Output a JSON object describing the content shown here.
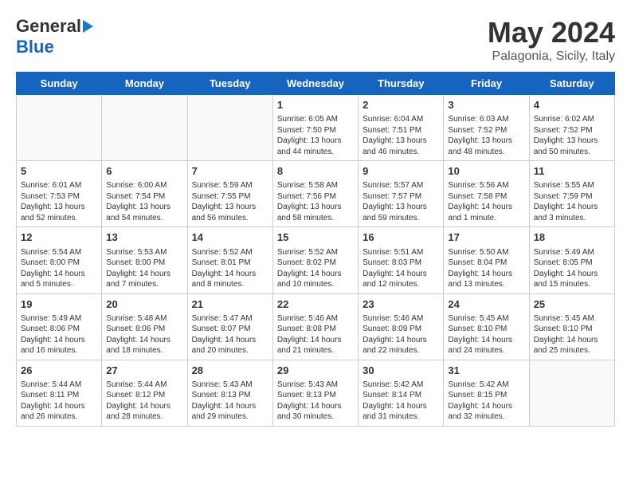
{
  "header": {
    "logo_general": "General",
    "logo_blue": "Blue",
    "main_title": "May 2024",
    "subtitle": "Palagonia, Sicily, Italy"
  },
  "weekdays": [
    "Sunday",
    "Monday",
    "Tuesday",
    "Wednesday",
    "Thursday",
    "Friday",
    "Saturday"
  ],
  "weeks": [
    [
      {
        "day": "",
        "info": ""
      },
      {
        "day": "",
        "info": ""
      },
      {
        "day": "",
        "info": ""
      },
      {
        "day": "1",
        "info": "Sunrise: 6:05 AM\nSunset: 7:50 PM\nDaylight: 13 hours\nand 44 minutes."
      },
      {
        "day": "2",
        "info": "Sunrise: 6:04 AM\nSunset: 7:51 PM\nDaylight: 13 hours\nand 46 minutes."
      },
      {
        "day": "3",
        "info": "Sunrise: 6:03 AM\nSunset: 7:52 PM\nDaylight: 13 hours\nand 48 minutes."
      },
      {
        "day": "4",
        "info": "Sunrise: 6:02 AM\nSunset: 7:52 PM\nDaylight: 13 hours\nand 50 minutes."
      }
    ],
    [
      {
        "day": "5",
        "info": "Sunrise: 6:01 AM\nSunset: 7:53 PM\nDaylight: 13 hours\nand 52 minutes."
      },
      {
        "day": "6",
        "info": "Sunrise: 6:00 AM\nSunset: 7:54 PM\nDaylight: 13 hours\nand 54 minutes."
      },
      {
        "day": "7",
        "info": "Sunrise: 5:59 AM\nSunset: 7:55 PM\nDaylight: 13 hours\nand 56 minutes."
      },
      {
        "day": "8",
        "info": "Sunrise: 5:58 AM\nSunset: 7:56 PM\nDaylight: 13 hours\nand 58 minutes."
      },
      {
        "day": "9",
        "info": "Sunrise: 5:57 AM\nSunset: 7:57 PM\nDaylight: 13 hours\nand 59 minutes."
      },
      {
        "day": "10",
        "info": "Sunrise: 5:56 AM\nSunset: 7:58 PM\nDaylight: 14 hours\nand 1 minute."
      },
      {
        "day": "11",
        "info": "Sunrise: 5:55 AM\nSunset: 7:59 PM\nDaylight: 14 hours\nand 3 minutes."
      }
    ],
    [
      {
        "day": "12",
        "info": "Sunrise: 5:54 AM\nSunset: 8:00 PM\nDaylight: 14 hours\nand 5 minutes."
      },
      {
        "day": "13",
        "info": "Sunrise: 5:53 AM\nSunset: 8:00 PM\nDaylight: 14 hours\nand 7 minutes."
      },
      {
        "day": "14",
        "info": "Sunrise: 5:52 AM\nSunset: 8:01 PM\nDaylight: 14 hours\nand 8 minutes."
      },
      {
        "day": "15",
        "info": "Sunrise: 5:52 AM\nSunset: 8:02 PM\nDaylight: 14 hours\nand 10 minutes."
      },
      {
        "day": "16",
        "info": "Sunrise: 5:51 AM\nSunset: 8:03 PM\nDaylight: 14 hours\nand 12 minutes."
      },
      {
        "day": "17",
        "info": "Sunrise: 5:50 AM\nSunset: 8:04 PM\nDaylight: 14 hours\nand 13 minutes."
      },
      {
        "day": "18",
        "info": "Sunrise: 5:49 AM\nSunset: 8:05 PM\nDaylight: 14 hours\nand 15 minutes."
      }
    ],
    [
      {
        "day": "19",
        "info": "Sunrise: 5:49 AM\nSunset: 8:06 PM\nDaylight: 14 hours\nand 16 minutes."
      },
      {
        "day": "20",
        "info": "Sunrise: 5:48 AM\nSunset: 8:06 PM\nDaylight: 14 hours\nand 18 minutes."
      },
      {
        "day": "21",
        "info": "Sunrise: 5:47 AM\nSunset: 8:07 PM\nDaylight: 14 hours\nand 20 minutes."
      },
      {
        "day": "22",
        "info": "Sunrise: 5:46 AM\nSunset: 8:08 PM\nDaylight: 14 hours\nand 21 minutes."
      },
      {
        "day": "23",
        "info": "Sunrise: 5:46 AM\nSunset: 8:09 PM\nDaylight: 14 hours\nand 22 minutes."
      },
      {
        "day": "24",
        "info": "Sunrise: 5:45 AM\nSunset: 8:10 PM\nDaylight: 14 hours\nand 24 minutes."
      },
      {
        "day": "25",
        "info": "Sunrise: 5:45 AM\nSunset: 8:10 PM\nDaylight: 14 hours\nand 25 minutes."
      }
    ],
    [
      {
        "day": "26",
        "info": "Sunrise: 5:44 AM\nSunset: 8:11 PM\nDaylight: 14 hours\nand 26 minutes."
      },
      {
        "day": "27",
        "info": "Sunrise: 5:44 AM\nSunset: 8:12 PM\nDaylight: 14 hours\nand 28 minutes."
      },
      {
        "day": "28",
        "info": "Sunrise: 5:43 AM\nSunset: 8:13 PM\nDaylight: 14 hours\nand 29 minutes."
      },
      {
        "day": "29",
        "info": "Sunrise: 5:43 AM\nSunset: 8:13 PM\nDaylight: 14 hours\nand 30 minutes."
      },
      {
        "day": "30",
        "info": "Sunrise: 5:42 AM\nSunset: 8:14 PM\nDaylight: 14 hours\nand 31 minutes."
      },
      {
        "day": "31",
        "info": "Sunrise: 5:42 AM\nSunset: 8:15 PM\nDaylight: 14 hours\nand 32 minutes."
      },
      {
        "day": "",
        "info": ""
      }
    ]
  ]
}
